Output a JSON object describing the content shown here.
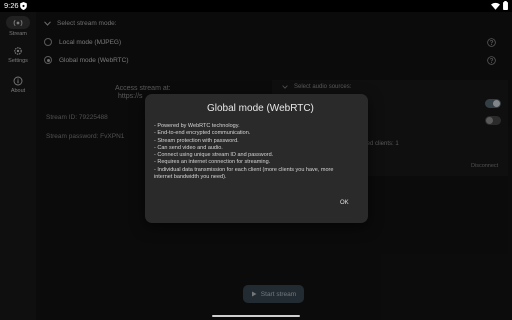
{
  "status_bar": {
    "time": "9:26"
  },
  "nav_rail": {
    "items": [
      {
        "label": "Stream",
        "icon": "stream-icon",
        "selected": true
      },
      {
        "label": "Settings",
        "icon": "gear-icon",
        "selected": false
      },
      {
        "label": "About",
        "icon": "info-icon",
        "selected": false
      }
    ]
  },
  "stream_mode": {
    "header": "Select stream mode:",
    "options": [
      {
        "label": "Local mode (MJPEG)",
        "checked": false
      },
      {
        "label": "Global mode (WebRTC)",
        "checked": true
      }
    ]
  },
  "background": {
    "access_title": "Access stream at:",
    "access_url": "https://s",
    "stream_id": "Stream ID: 79225488",
    "stream_password": "Stream password: FvXPN1",
    "audio_header": "Select audio sources:",
    "connected_clients": "nnected clients: 1",
    "disconnect_label": "Disconnect"
  },
  "start_button": {
    "label": "Start stream"
  },
  "dialog": {
    "title": "Global mode (WebRTC)",
    "lines": [
      "- Powered by WebRTC technology.",
      "- End-to-end encrypted communication.",
      "- Stream protection with password.",
      "- Can send video and audio.",
      "- Connect using unique stream ID and password.",
      "- Requires an internet connection for streaming.",
      "- Individual data transmission for each client (more clients you have, more",
      "internet bandwidth you need)."
    ],
    "ok_label": "OK"
  },
  "colors": {
    "toggle_on_track": "#5b6b78",
    "toggle_off_track": "#4a4a4a",
    "dialog_bg": "#2a2a2a",
    "start_button_bg": "#3b4a56"
  }
}
